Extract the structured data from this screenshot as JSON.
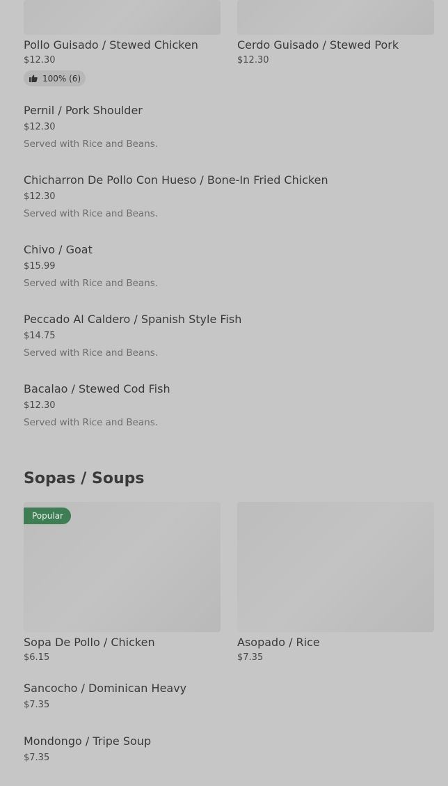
{
  "top_row": [
    {
      "name": "Pollo Guisado / Stewed Chicken",
      "price": "$12.30",
      "rating": "100% (6)"
    },
    {
      "name": "Cerdo Guisado / Stewed Pork",
      "price": "$12.30"
    }
  ],
  "list_items": [
    {
      "name": "Pernil / Pork Shoulder",
      "price": "$12.30",
      "desc": "Served with Rice and Beans."
    },
    {
      "name": "Chicharron De Pollo Con Hueso / Bone-In Fried Chicken",
      "price": "$12.30",
      "desc": "Served with Rice and Beans."
    },
    {
      "name": "Chivo / Goat",
      "price": "$15.99",
      "desc": "Served with Rice and Beans."
    },
    {
      "name": "Peccado Al Caldero / Spanish Style Fish",
      "price": "$14.75",
      "desc": "Served with Rice and Beans."
    },
    {
      "name": "Bacalao / Stewed Cod Fish",
      "price": "$12.30",
      "desc": "Served with Rice and Beans."
    }
  ],
  "soups_section": {
    "title": "Sopas / Soups",
    "popular_label": "Popular",
    "cards": [
      {
        "name": "Sopa De Pollo / Chicken",
        "price": "$6.15"
      },
      {
        "name": "Asopado / Rice",
        "price": "$7.35"
      }
    ],
    "items": [
      {
        "name": "Sancocho / Dominican Heavy",
        "price": "$7.35"
      },
      {
        "name": "Mondongo / Tripe Soup",
        "price": "$7.35"
      }
    ]
  },
  "colors": {
    "overlay_bg": "#c6c6c6",
    "popular_badge": "#3f7d55"
  },
  "icons": {
    "rating": "thumbs-up-icon"
  }
}
